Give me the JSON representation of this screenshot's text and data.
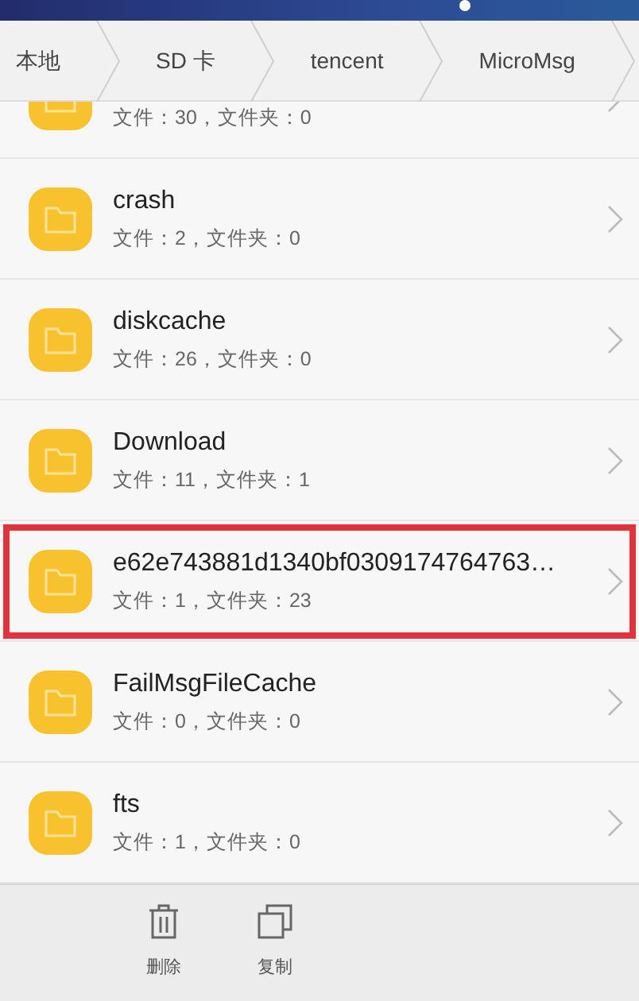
{
  "breadcrumb": [
    {
      "label": "本地"
    },
    {
      "label": "SD 卡"
    },
    {
      "label": "tencent"
    },
    {
      "label": "MicroMsg"
    }
  ],
  "folders": [
    {
      "info": "文件：30，文件夹：0",
      "highlighted": false
    },
    {
      "name": "crash",
      "info": "文件：2，文件夹：0",
      "highlighted": false
    },
    {
      "name": "diskcache",
      "info": "文件：26，文件夹：0",
      "highlighted": false
    },
    {
      "name": "Download",
      "info": "文件：11，文件夹：1",
      "highlighted": false
    },
    {
      "name": "e62e743881d1340bf0309174764763…",
      "info": "文件：1，文件夹：23",
      "highlighted": true
    },
    {
      "name": "FailMsgFileCache",
      "info": "文件：0，文件夹：0",
      "highlighted": false
    },
    {
      "name": "fts",
      "info": "文件：1，文件夹：0",
      "highlighted": false
    }
  ],
  "toolbar": [
    {
      "kind": "delete",
      "label": "删除"
    },
    {
      "kind": "copy",
      "label": "复制"
    }
  ]
}
